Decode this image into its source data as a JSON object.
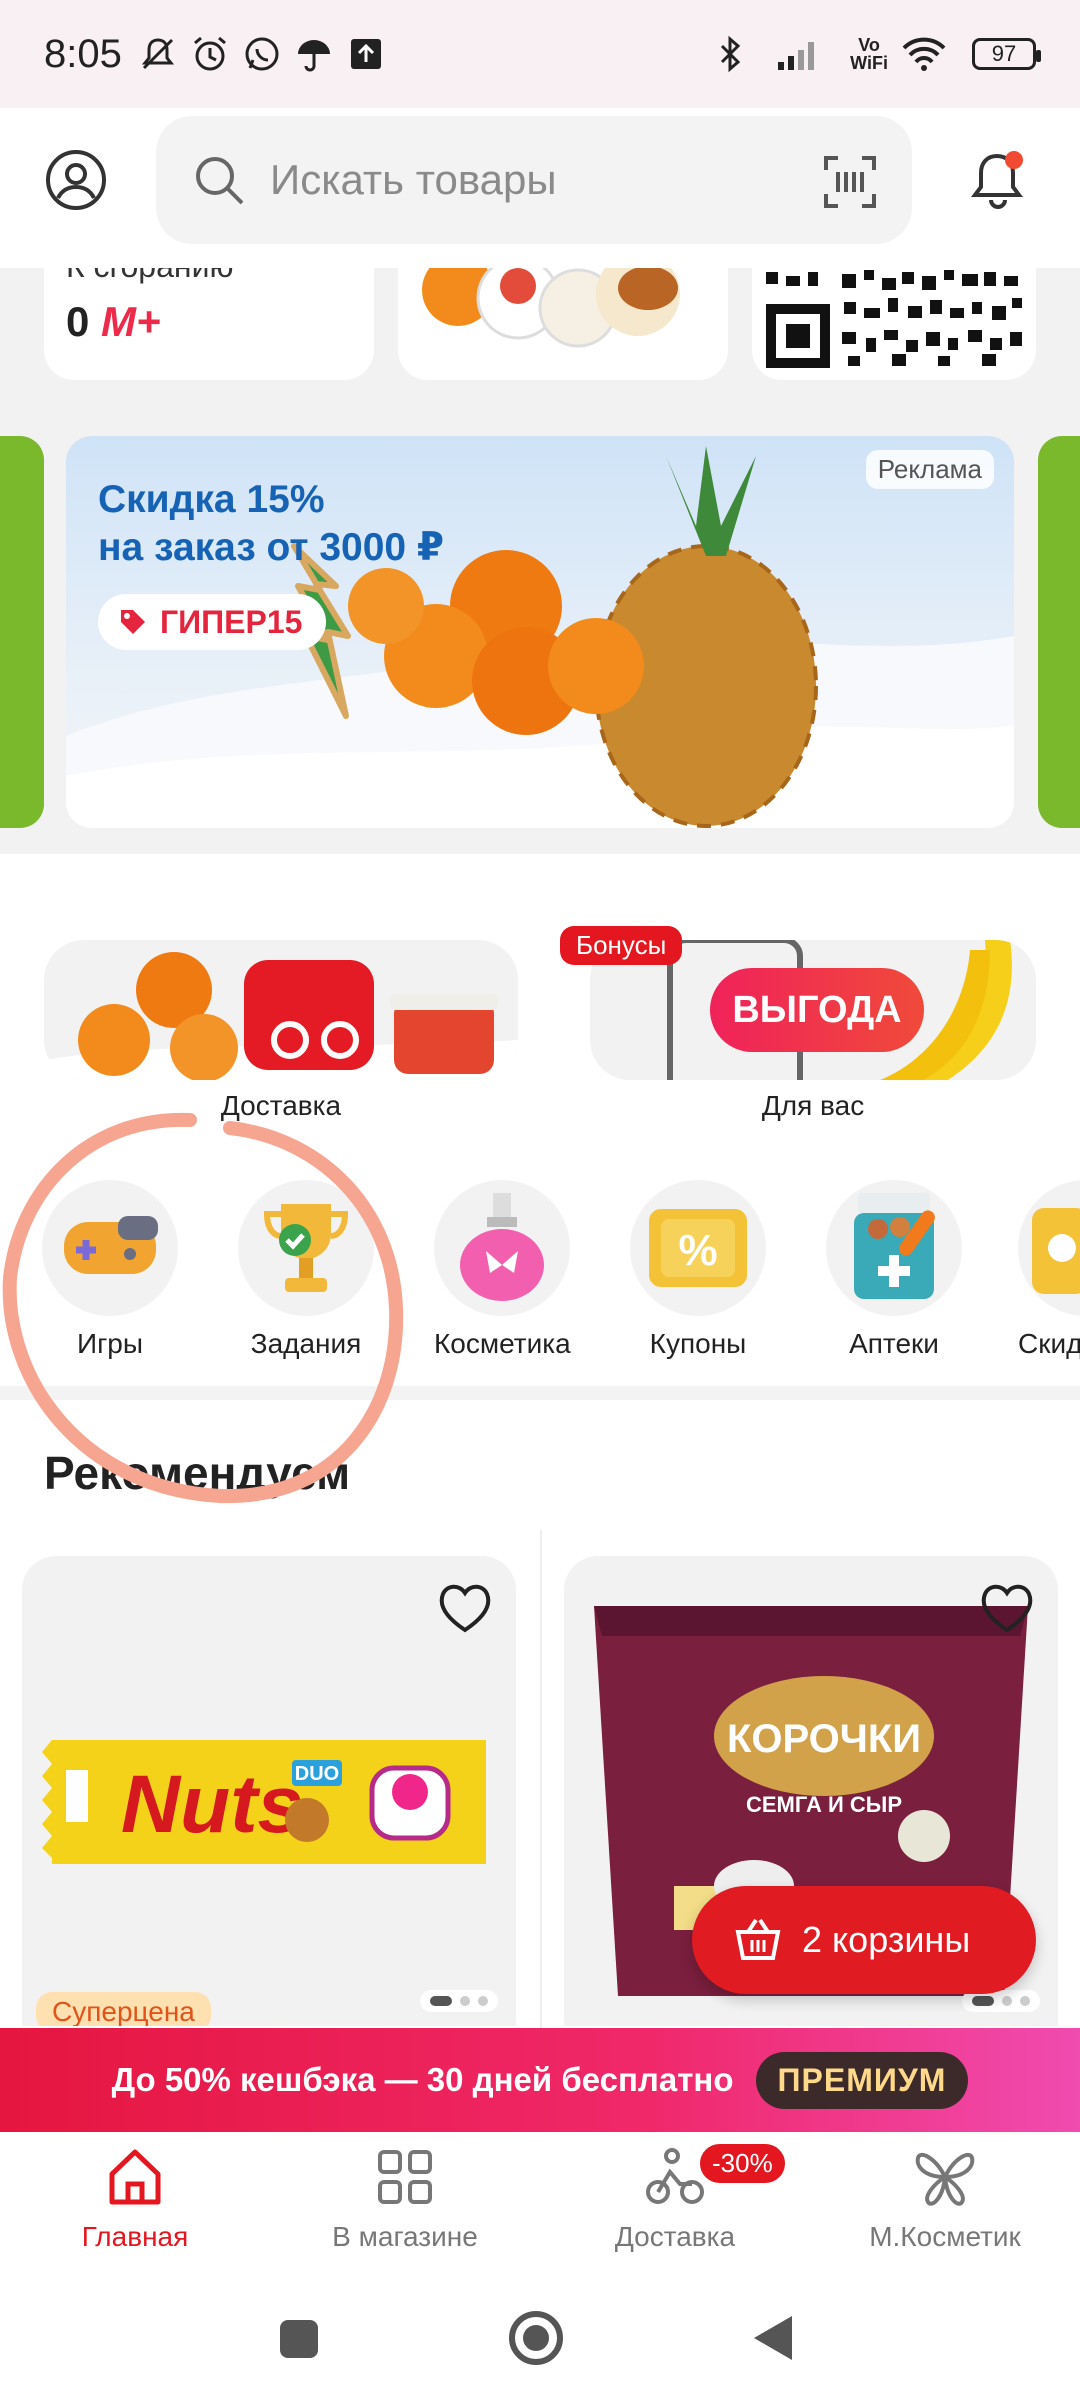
{
  "status": {
    "time": "8:05",
    "battery": "97",
    "vowifi_top": "Vo",
    "vowifi_bottom": "WiFi"
  },
  "header": {
    "search_placeholder": "Искать товары"
  },
  "top_cards": {
    "burn_label": "К сгоранию",
    "burn_value": "0",
    "burn_currency": "М+"
  },
  "banner": {
    "title_line1": "Скидка 15%",
    "title_line2": "на заказ от 3000 ₽",
    "promo_code": "ГИПЕР15",
    "ad_label": "Реклама"
  },
  "big_categories": [
    {
      "label": "Доставка"
    },
    {
      "label": "Для вас",
      "badge": "Бонусы",
      "button": "ВЫГОДА"
    }
  ],
  "categories": [
    {
      "label": "Игры"
    },
    {
      "label": "Задания"
    },
    {
      "label": "Косметика"
    },
    {
      "label": "Купоны"
    },
    {
      "label": "Аптеки"
    },
    {
      "label": "Скид"
    }
  ],
  "recommend": {
    "title": "Рекомендуем",
    "products": [
      {
        "brand": "Nuts",
        "sub": "DUO",
        "badge": "Суперцена"
      },
      {
        "brand": "3 КОРОЧКИ",
        "flavor": "СЁМГА И СЫР"
      }
    ]
  },
  "basket": {
    "label": "2 корзины"
  },
  "premium": {
    "text": "До 50% кешбэка — 30 дней бесплатно",
    "button": "ПРЕМИУМ"
  },
  "bottom_nav": [
    {
      "label": "Главная",
      "active": true
    },
    {
      "label": "В магазине"
    },
    {
      "label": "Доставка",
      "badge": "-30%"
    },
    {
      "label": "М.Косметик"
    }
  ],
  "colors": {
    "brand_red": "#e4161f",
    "banner_blue": "#1662b5"
  }
}
